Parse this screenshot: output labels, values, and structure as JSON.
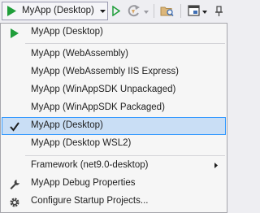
{
  "toolbar": {
    "run_target_label": "MyApp (Desktop)"
  },
  "menu": {
    "header_item": "MyApp (Desktop)",
    "profiles": [
      "MyApp (WebAssembly)",
      "MyApp (WebAssembly IIS Express)",
      "MyApp (WinAppSDK Unpackaged)",
      "MyApp (WinAppSDK Packaged)",
      "MyApp (Desktop)",
      "MyApp (Desktop WSL2)"
    ],
    "selected_index": 4,
    "framework_item": "Framework (net9.0-desktop)",
    "debug_properties_item": "MyApp Debug Properties",
    "configure_item": "Configure Startup Projects..."
  },
  "colors": {
    "play_green": "#1f9e3a",
    "selection_bg": "#c9def5",
    "selection_border": "#3399ff"
  }
}
